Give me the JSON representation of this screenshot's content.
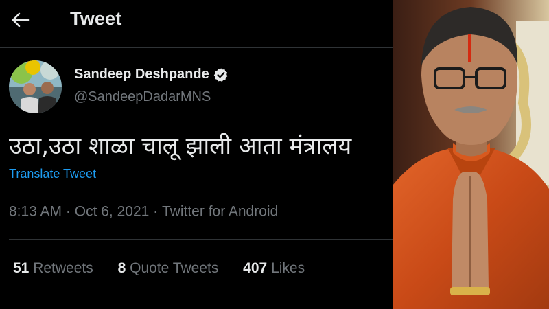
{
  "header": {
    "title": "Tweet",
    "back_icon": "arrow-left-icon"
  },
  "author": {
    "display_name": "Sandeep Deshpande",
    "handle": "@SandeepDadarMNS",
    "verified_icon": "verified-badge-icon"
  },
  "tweet": {
    "text": "उठा,उठा शाळा चालू झाली आता मंत्रालय",
    "translate_label": "Translate Tweet",
    "time": "8:13 AM",
    "date": "Oct 6, 2021",
    "source": "Twitter for Android",
    "dot": "·"
  },
  "stats": [
    {
      "count": "51",
      "label": "Retweets"
    },
    {
      "count": "8",
      "label": "Quote Tweets"
    },
    {
      "count": "407",
      "label": "Likes"
    }
  ],
  "colors": {
    "background": "#000000",
    "text": "#e7e9ea",
    "muted": "#71767b",
    "link": "#1d9bf0",
    "divider": "#2f3336",
    "kurta": "#d0531c"
  }
}
